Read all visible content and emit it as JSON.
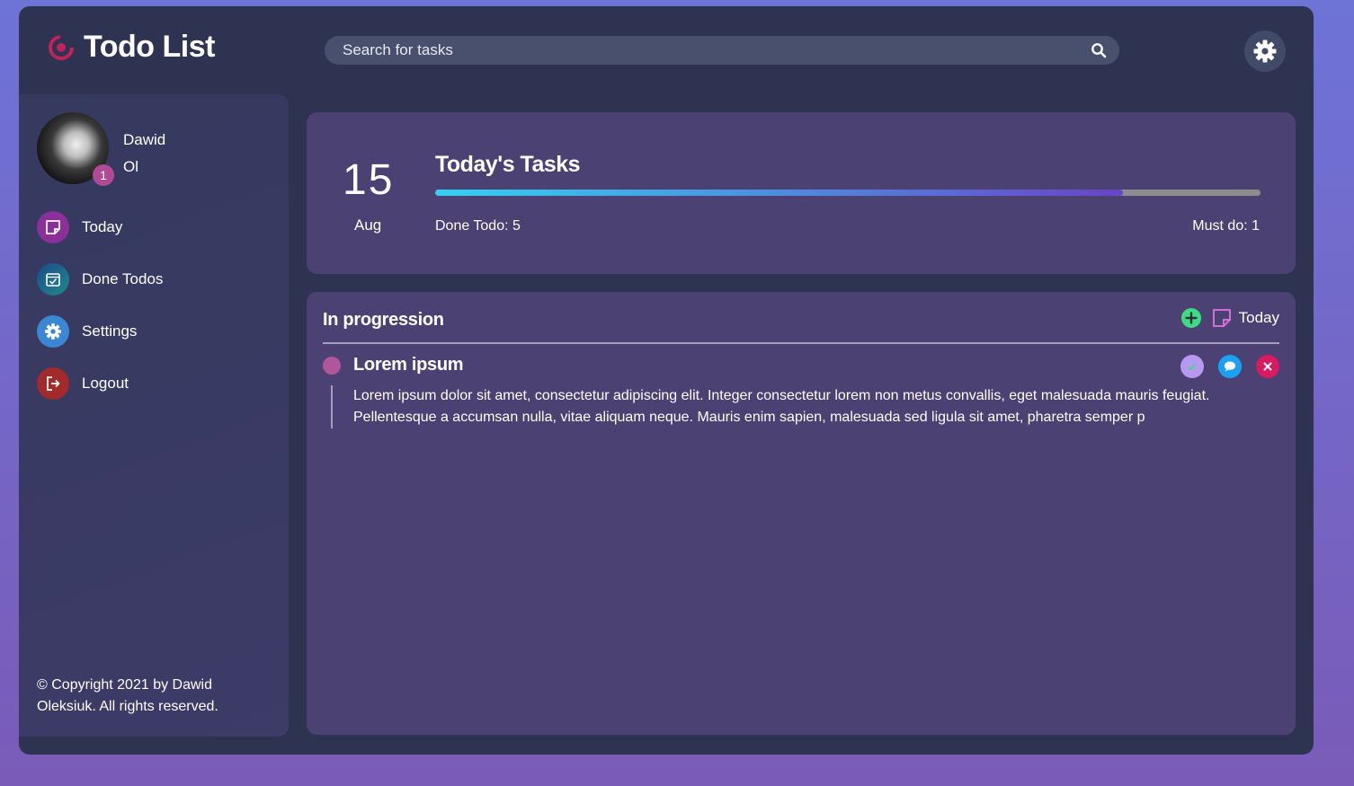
{
  "header": {
    "title": "Todo List",
    "search_placeholder": "Search for tasks"
  },
  "profile": {
    "first_name": "Dawid",
    "last_name": "Ol",
    "badge_count": "1"
  },
  "sidebar": {
    "items": [
      {
        "label": "Today",
        "icon": "sticky-note-icon"
      },
      {
        "label": "Done Todos",
        "icon": "check-list-icon"
      },
      {
        "label": "Settings",
        "icon": "gear-icon"
      },
      {
        "label": "Logout",
        "icon": "logout-icon"
      }
    ],
    "copyright": "© Copyright 2021 by Dawid Oleksiuk. All rights reserved."
  },
  "summary": {
    "day": "15",
    "month": "Aug",
    "title": "Today's Tasks",
    "progress": 0.833,
    "done_label": "Done Todo: 5",
    "must_label": "Must do: 1"
  },
  "main": {
    "section_title": "In progression",
    "filter_label": "Today",
    "tasks": [
      {
        "title": "Lorem ipsum",
        "body": "Lorem ipsum dolor sit amet, consectetur adipiscing elit. Integer consectetur lorem non metus convallis, eget malesuada mauris feugiat. Pellentesque a accumsan nulla, vitae aliquam neque. Mauris enim sapien, malesuada sed ligula sit amet, pharetra semper p"
      }
    ]
  },
  "colors": {
    "app_bg": "#2e3352",
    "card_bg": "#4b4173",
    "accent_pink": "#b0579c",
    "add_green": "#3ddc84",
    "done_purple": "#b59af0",
    "comment_blue": "#1ca0f2",
    "delete_red": "#d81b60"
  }
}
